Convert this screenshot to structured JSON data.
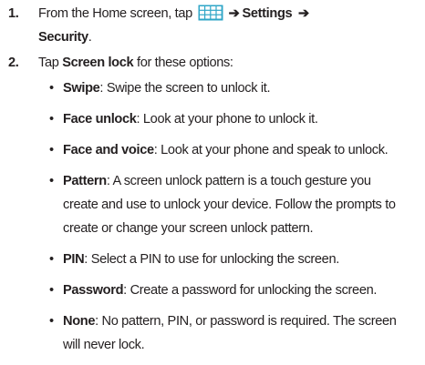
{
  "steps": [
    {
      "number": "1.",
      "line1_prefix": "From the Home screen, tap",
      "line1_settings": "Settings",
      "line2_security": "Security",
      "line2_suffix": ".",
      "arrow": "➔",
      "icon": "apps-grid-icon",
      "icon_color": "#2fa6c7"
    },
    {
      "number": "2.",
      "prefix": "Tap ",
      "bold": "Screen lock",
      "suffix": " for these options:"
    }
  ],
  "options": [
    {
      "term": "Swipe",
      "lines": [
        ": Swipe the screen to unlock it."
      ]
    },
    {
      "term": "Face unlock",
      "lines": [
        ": Look at your phone to unlock it."
      ]
    },
    {
      "term": "Face and voice",
      "lines": [
        ": Look at your phone and speak to unlock."
      ]
    },
    {
      "term": "Pattern",
      "lines": [
        ": A screen unlock pattern is a touch gesture you",
        "create and use to unlock your device. Follow the prompts to",
        "create or change your screen unlock pattern."
      ]
    },
    {
      "term": "PIN",
      "lines": [
        ": Select a PIN to use for unlocking the screen."
      ]
    },
    {
      "term": "Password",
      "lines": [
        ": Create a password for unlocking the screen."
      ]
    },
    {
      "term": "None",
      "lines": [
        ": No pattern, PIN, or password is required. The screen",
        "will never lock."
      ]
    }
  ],
  "bullet": "•"
}
